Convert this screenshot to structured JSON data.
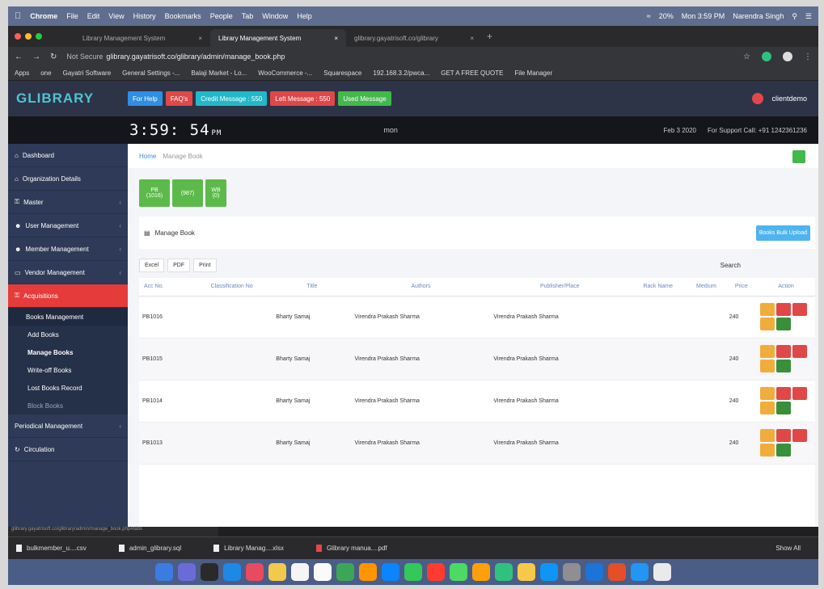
{
  "menubar": {
    "apple": "",
    "items": [
      "Chrome",
      "File",
      "Edit",
      "View",
      "History",
      "Bookmarks",
      "People",
      "Tab",
      "Window",
      "Help"
    ],
    "battery": "20%",
    "clock": "Mon 3:59 PM",
    "user": "Narendra Singh"
  },
  "tabs": [
    {
      "label": "Library Management System",
      "active": false
    },
    {
      "label": "Library Management System",
      "active": true
    },
    {
      "label": "glibrary.gayatrisoft.co/glibrary",
      "active": false
    }
  ],
  "address": {
    "security": "Not Secure",
    "url": "glibrary.gayatrisoft.co/glibrary/admin/manage_book.php"
  },
  "bookmarks": [
    "Apps",
    "one",
    "Gayatri Software",
    "General Settings -...",
    "Balaji Market - Lo...",
    "WooCommerce -...",
    "Squarespace",
    "192.168.3.2/pwca...",
    "GET A FREE QUOTE",
    "File Manager"
  ],
  "app": {
    "logo": "GLIBRARY",
    "header_buttons": [
      {
        "label": "For Help",
        "color": "#2f8fe3"
      },
      {
        "label": "FAQ's",
        "color": "#e04848"
      },
      {
        "label": "Credit Message : 550",
        "color": "#21b9c9"
      },
      {
        "label": "Left Message : 550",
        "color": "#e04848"
      },
      {
        "label": "Used Message",
        "color": "#43b84c"
      }
    ],
    "username": "clientdemo"
  },
  "clockbar": {
    "time": "3:59: 54",
    "ampm": "PM",
    "user": "mon",
    "date": "Feb 3 2020",
    "support": "For Support Call: +91 1242361236"
  },
  "sidebar": {
    "items": [
      {
        "label": "Dashboard",
        "icon": "home-icon"
      },
      {
        "label": "Organization Details",
        "icon": "home-icon"
      },
      {
        "label": "Master",
        "icon": "key-icon"
      },
      {
        "label": "User Management",
        "icon": "users-icon"
      },
      {
        "label": "Member Management",
        "icon": "users-icon"
      },
      {
        "label": "Vendor Management",
        "icon": "monitor-icon"
      },
      {
        "label": "Acquisitions",
        "icon": "key-icon"
      }
    ],
    "submenu_head": "Books Management",
    "submenu": [
      "Add Books",
      "Manage Books",
      "Write-off Books",
      "Lost Books Record",
      "Block Books"
    ],
    "after": [
      "Periodical Management",
      "Circulation"
    ]
  },
  "breadcrumb": {
    "home": "Home",
    "current": "Manage Book"
  },
  "stats": [
    {
      "top": "PB",
      "bottom": "(1016)"
    },
    {
      "top": "",
      "bottom": "(987)"
    },
    {
      "top": "WB",
      "bottom": "(0)"
    }
  ],
  "panel": {
    "title": "Manage Book",
    "bulk_button": "Books Bulk Upload"
  },
  "tools": [
    "Excel",
    "PDF",
    "Print"
  ],
  "search_label": "Search",
  "table": {
    "headers": [
      "Acc No.",
      "Classification No",
      "Title",
      "Authors",
      "Publisher/Place",
      "Rack Name",
      "Medium",
      "Price",
      "Action"
    ],
    "rows": [
      {
        "acc": "PB1016",
        "class": "",
        "title": "Bharty Samaj",
        "authors": "Virendra Prakash Sharma",
        "publisher": "Virendra Prakash Sharma",
        "rack": "",
        "medium": "",
        "price": "240"
      },
      {
        "acc": "PB1015",
        "class": "",
        "title": "Bharty Samaj",
        "authors": "Virendra Prakash Sharma",
        "publisher": "Virendra Prakash Sharma",
        "rack": "",
        "medium": "",
        "price": "240"
      },
      {
        "acc": "PB1014",
        "class": "",
        "title": "Bharty Samaj",
        "authors": "Virendra Prakash Sharma",
        "publisher": "Virendra Prakash Sharma",
        "rack": "",
        "medium": "",
        "price": "240"
      },
      {
        "acc": "PB1013",
        "class": "",
        "title": "Bharty Samaj",
        "authors": "Virendra Prakash Sharma",
        "publisher": "Virendra Prakash Sharma",
        "rack": "",
        "medium": "",
        "price": "240"
      }
    ]
  },
  "status_url": "glibrary.gayatrisoft.co/glibrary/admin/manage_book.php#tabs",
  "downloads": [
    "bulkmember_u....csv",
    "admin_glibrary.sql",
    "Library Manag....xlsx",
    "Glibrary manua....pdf"
  ],
  "show_all": "Show All"
}
